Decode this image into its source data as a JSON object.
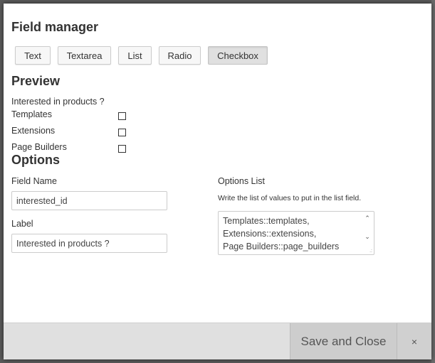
{
  "modal": {
    "title": "Field manager",
    "type_buttons": [
      {
        "label": "Text",
        "active": false
      },
      {
        "label": "Textarea",
        "active": false
      },
      {
        "label": "List",
        "active": false
      },
      {
        "label": "Radio",
        "active": false
      },
      {
        "label": "Checkbox",
        "active": true
      }
    ]
  },
  "preview": {
    "heading": "Preview",
    "question": "Interested in products ?",
    "options": [
      {
        "label": "Templates",
        "checked": false
      },
      {
        "label": "Extensions",
        "checked": false
      },
      {
        "label": "Page Builders",
        "checked": false
      }
    ]
  },
  "options": {
    "heading": "Options",
    "field_name_label": "Field Name",
    "field_name_value": "interested_id",
    "label_label": "Label",
    "label_value": "Interested in products ?",
    "options_list_label": "Options List",
    "options_list_help": "Write the list of values to put in the list field.",
    "options_list_value": "Templates::templates,\nExtensions::extensions,\nPage Builders::page_builders"
  },
  "footer": {
    "save_label": "Save and Close",
    "close_label": "×"
  }
}
